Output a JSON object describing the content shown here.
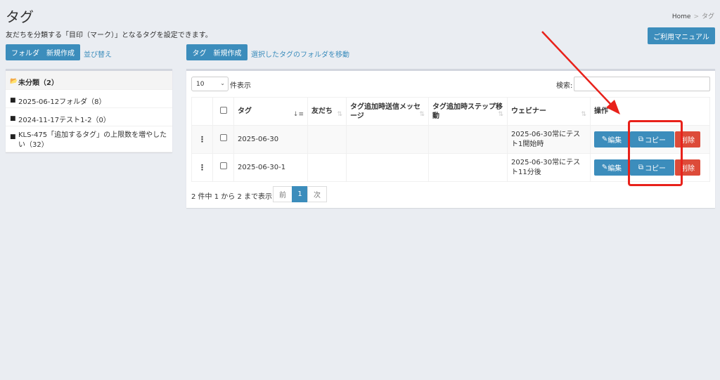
{
  "header": {
    "title": "タグ",
    "breadcrumb_home": "Home",
    "breadcrumb_sep": ">",
    "breadcrumb_current": "タグ",
    "description": "友だちを分類する「目印（マーク）」となるタグを設定できます。",
    "manual_button": "ご利用マニュアル"
  },
  "toolbar": {
    "folder_new": "フォルダ　新規作成",
    "sort": "並び替え",
    "tag_new": "タグ　新規作成",
    "move_to_folder": "選択したタグのフォルダを移動"
  },
  "sidebar": {
    "items": [
      {
        "label": "未分類（2）",
        "icon": "folder-open-icon"
      },
      {
        "label": "2025-06-12フォルダ（8）",
        "icon": "folder-icon"
      },
      {
        "label": "2024-11-17テスト1-2（0）",
        "icon": "folder-icon"
      },
      {
        "label": "KLS-475「追加するタグ」の上限数を増やしたい（32）",
        "icon": "folder-icon"
      }
    ]
  },
  "table_controls": {
    "length_value": "10",
    "length_label": "件表示",
    "search_label": "検索:",
    "search_value": ""
  },
  "table": {
    "headers": [
      "タグ",
      "友だち",
      "タグ追加時送信メッセージ",
      "タグ追加時ステップ移動",
      "ウェビナー",
      "操作"
    ],
    "rows": [
      {
        "tag": "2025-06-30",
        "friends": "",
        "message": "",
        "step": "",
        "webinar": "2025-06-30常にテスト1開始時"
      },
      {
        "tag": "2025-06-30-1",
        "friends": "",
        "message": "",
        "step": "",
        "webinar": "2025-06-30常にテスト11分後"
      }
    ],
    "edit_label": "編集",
    "copy_label": "コピー",
    "delete_label": "削除"
  },
  "pagination": {
    "info": "2 件中 1 から 2 まで表示",
    "prev": "前",
    "current": "1",
    "next": "次"
  },
  "colors": {
    "primary": "#3c8dbc",
    "danger": "#dd4b39",
    "annotation": "#e8211a"
  }
}
